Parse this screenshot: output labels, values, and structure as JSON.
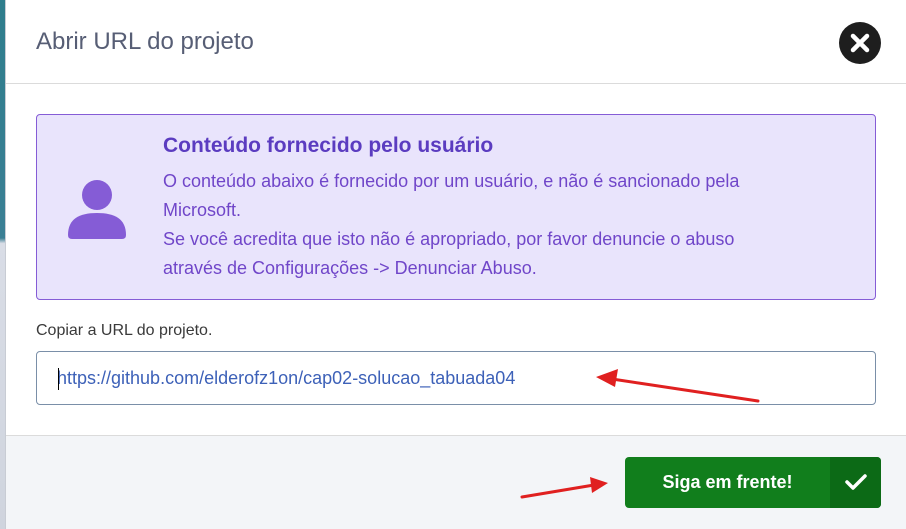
{
  "dialog": {
    "title": "Abrir URL do projeto",
    "close_icon": "close-icon"
  },
  "notice": {
    "icon": "user-icon",
    "title": "Conteúdo fornecido pelo usuário",
    "lines": [
      "O conteúdo abaixo é fornecido por um usuário, e não é sancionado pela",
      "Microsoft.",
      "Se você acredita que isto não é apropriado, por favor denuncie o abuso",
      "através de Configurações -> Denunciar Abuso."
    ]
  },
  "url": {
    "label": "Copiar a URL do projeto.",
    "value": "https://github.com/elderofz1on/cap02-solucao_tabuada04"
  },
  "footer": {
    "go_label": "Siga em frente!",
    "go_icon": "checkmark-icon"
  },
  "colors": {
    "accent_purple": "#855cd6",
    "go_green": "#117e1c",
    "annotation_red": "#e02020"
  }
}
